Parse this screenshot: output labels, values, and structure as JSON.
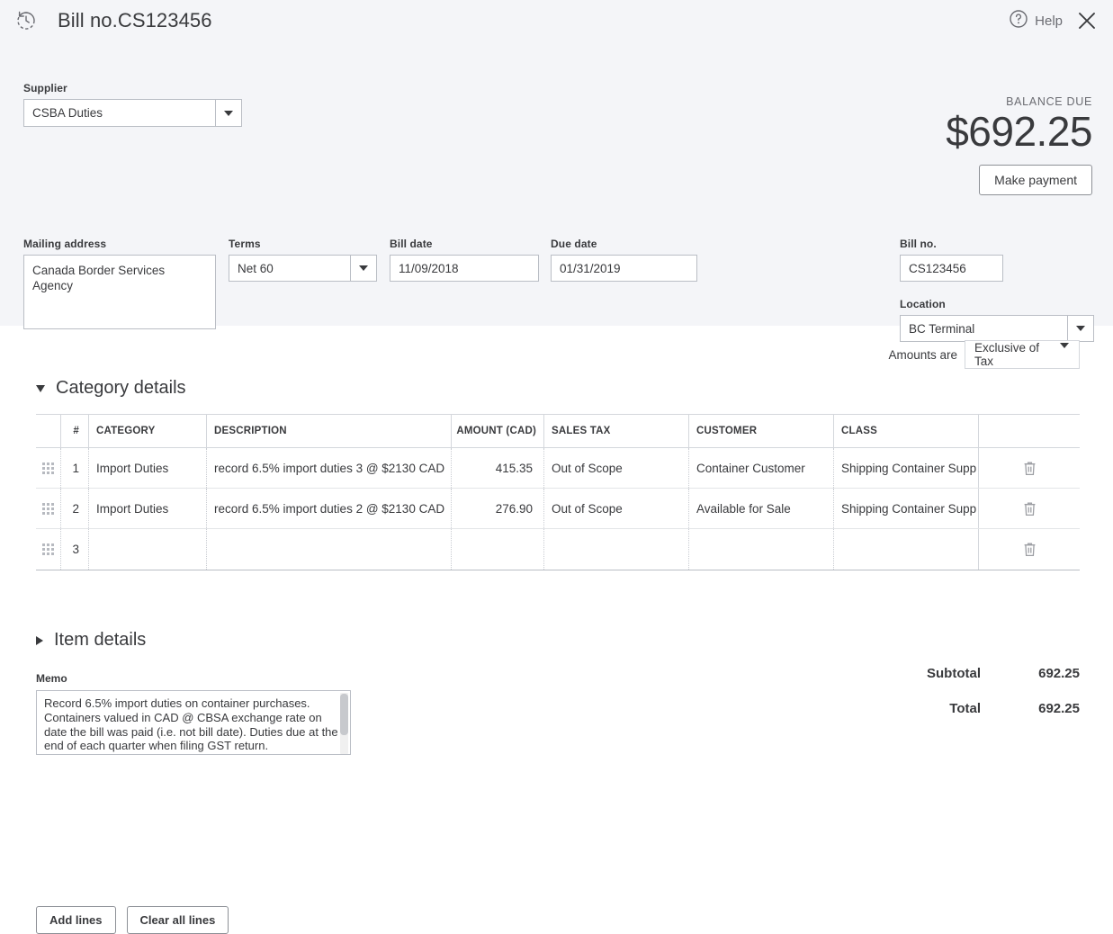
{
  "header": {
    "history_icon": "history-clock-icon",
    "title": "Bill no.CS123456",
    "help_label": "Help",
    "help_icon": "question-circle-icon",
    "close_icon": "close-x-icon"
  },
  "supplier": {
    "label": "Supplier",
    "value": "CSBA Duties"
  },
  "balance": {
    "label": "BALANCE DUE",
    "amount": "$692.25",
    "make_payment_label": "Make payment"
  },
  "mailing_address": {
    "label": "Mailing address",
    "value": "Canada Border Services Agency"
  },
  "terms": {
    "label": "Terms",
    "value": "Net 60"
  },
  "bill_date": {
    "label": "Bill date",
    "value": "11/09/2018"
  },
  "due_date": {
    "label": "Due date",
    "value": "01/31/2019"
  },
  "bill_no": {
    "label": "Bill no.",
    "value": "CS123456"
  },
  "location": {
    "label": "Location",
    "value": "BC Terminal"
  },
  "amounts_are": {
    "label": "Amounts are",
    "value": "Exclusive of Tax"
  },
  "category_details": {
    "title": "Category details",
    "expanded": true,
    "columns": {
      "num": "#",
      "category": "CATEGORY",
      "description": "DESCRIPTION",
      "amount": "AMOUNT (CAD)",
      "sales_tax": "SALES TAX",
      "customer": "CUSTOMER",
      "class": "CLASS"
    },
    "rows": [
      {
        "num": "1",
        "category": "Import Duties",
        "description": "record 6.5% import duties 3 @ $2130 CAD",
        "amount": "415.35",
        "sales_tax": "Out of Scope",
        "customer": "Container Customer",
        "class": "Shipping Container Supp"
      },
      {
        "num": "2",
        "category": "Import Duties",
        "description": "record 6.5% import duties 2 @ $2130 CAD",
        "amount": "276.90",
        "sales_tax": "Out of Scope",
        "customer": "Available for Sale",
        "class": "Shipping Container Supp"
      },
      {
        "num": "3",
        "category": "",
        "description": "",
        "amount": "",
        "sales_tax": "",
        "customer": "",
        "class": ""
      }
    ],
    "add_lines_label": "Add lines",
    "clear_all_lines_label": "Clear all lines"
  },
  "item_details": {
    "title": "Item details",
    "expanded": false
  },
  "memo": {
    "label": "Memo",
    "value": "Record 6.5% import duties on container purchases. Containers valued in CAD @ CBSA exchange rate on date the bill was paid (i.e. not bill date). Duties due at the end of each quarter when filing GST return."
  },
  "totals": {
    "subtotal_label": "Subtotal",
    "subtotal_value": "692.25",
    "total_label": "Total",
    "total_value": "692.25"
  },
  "colors": {
    "panel_bg": "#f4f5f8",
    "text": "#393a3d",
    "muted": "#6b6c72",
    "border": "#babec5"
  }
}
